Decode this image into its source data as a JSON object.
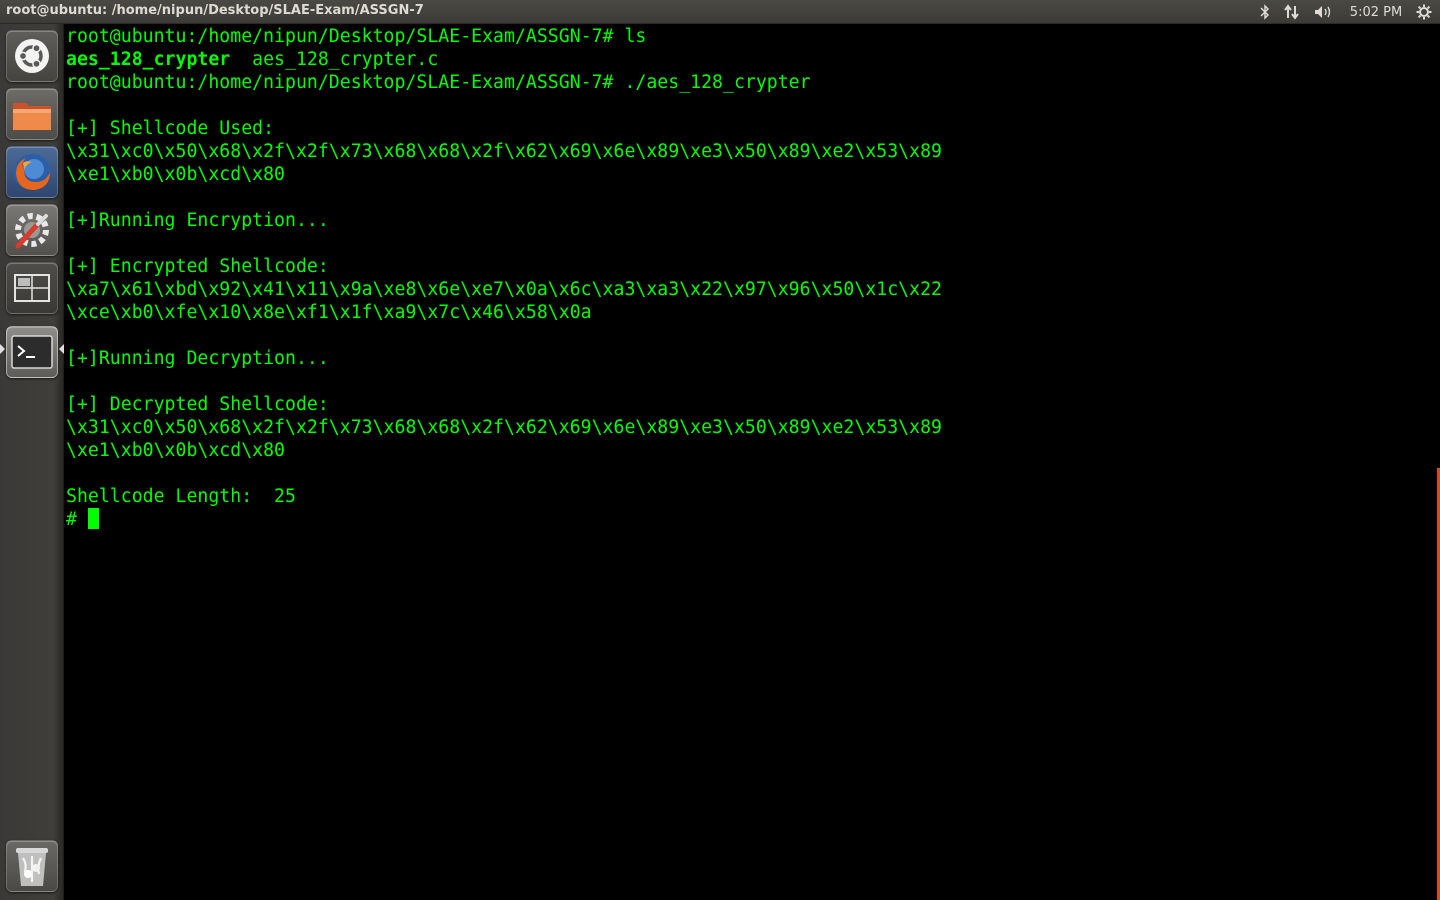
{
  "topbar": {
    "window_title": "root@ubuntu: /home/nipun/Desktop/SLAE-Exam/ASSGN-7",
    "indicators": {
      "bluetooth_icon": "bluetooth-icon",
      "network_icon": "network-icon",
      "volume_icon": "volume-icon",
      "clock": "5:02 PM",
      "settings_icon": "gear-icon"
    }
  },
  "launcher": {
    "items": [
      {
        "name": "dash-home",
        "icon": "ubuntu-logo-icon"
      },
      {
        "name": "files",
        "icon": "folder-icon"
      },
      {
        "name": "firefox",
        "icon": "firefox-icon"
      },
      {
        "name": "system-settings",
        "icon": "settings-wrench-icon"
      },
      {
        "name": "workspace-switcher",
        "icon": "workspace-icon"
      },
      {
        "name": "terminal",
        "icon": "terminal-icon",
        "active": true
      }
    ],
    "trash": {
      "name": "trash",
      "icon": "trash-icon"
    }
  },
  "terminal": {
    "prompt": "root@ubuntu:/home/nipun/Desktop/SLAE-Exam/ASSGN-7#",
    "lines": [
      {
        "text": "root@ubuntu:/home/nipun/Desktop/SLAE-Exam/ASSGN-7# ls"
      },
      {
        "parts": [
          {
            "text": "aes_128_crypter",
            "bold": true
          },
          {
            "text": "  aes_128_crypter.c",
            "bold": false
          }
        ]
      },
      {
        "text": "root@ubuntu:/home/nipun/Desktop/SLAE-Exam/ASSGN-7# ./aes_128_crypter"
      },
      {
        "text": ""
      },
      {
        "text": "[+] Shellcode Used:"
      },
      {
        "text": "\\x31\\xc0\\x50\\x68\\x2f\\x2f\\x73\\x68\\x68\\x2f\\x62\\x69\\x6e\\x89\\xe3\\x50\\x89\\xe2\\x53\\x89"
      },
      {
        "text": "\\xe1\\xb0\\x0b\\xcd\\x80"
      },
      {
        "text": ""
      },
      {
        "text": "[+]Running Encryption..."
      },
      {
        "text": ""
      },
      {
        "text": "[+] Encrypted Shellcode:"
      },
      {
        "text": "\\xa7\\x61\\xbd\\x92\\x41\\x11\\x9a\\xe8\\x6e\\xe7\\x0a\\x6c\\xa3\\xa3\\x22\\x97\\x96\\x50\\x1c\\x22"
      },
      {
        "text": "\\xce\\xb0\\xfe\\x10\\x8e\\xf1\\x1f\\xa9\\x7c\\x46\\x58\\x0a"
      },
      {
        "text": ""
      },
      {
        "text": "[+]Running Decryption..."
      },
      {
        "text": ""
      },
      {
        "text": "[+] Decrypted Shellcode:"
      },
      {
        "text": "\\x31\\xc0\\x50\\x68\\x2f\\x2f\\x73\\x68\\x68\\x2f\\x62\\x69\\x6e\\x89\\xe3\\x50\\x89\\xe2\\x53\\x89"
      },
      {
        "text": "\\xe1\\xb0\\x0b\\xcd\\x80"
      },
      {
        "text": ""
      },
      {
        "text": "Shellcode Length:  25"
      },
      {
        "text": "# ",
        "cursor": true
      }
    ],
    "colors": {
      "foreground": "#00ff00",
      "background": "#000000"
    }
  },
  "theme": {
    "panel_bg": "#3c3b37",
    "launcher_bg": "#3f3e3b",
    "accent_orange": "#dd4814"
  }
}
